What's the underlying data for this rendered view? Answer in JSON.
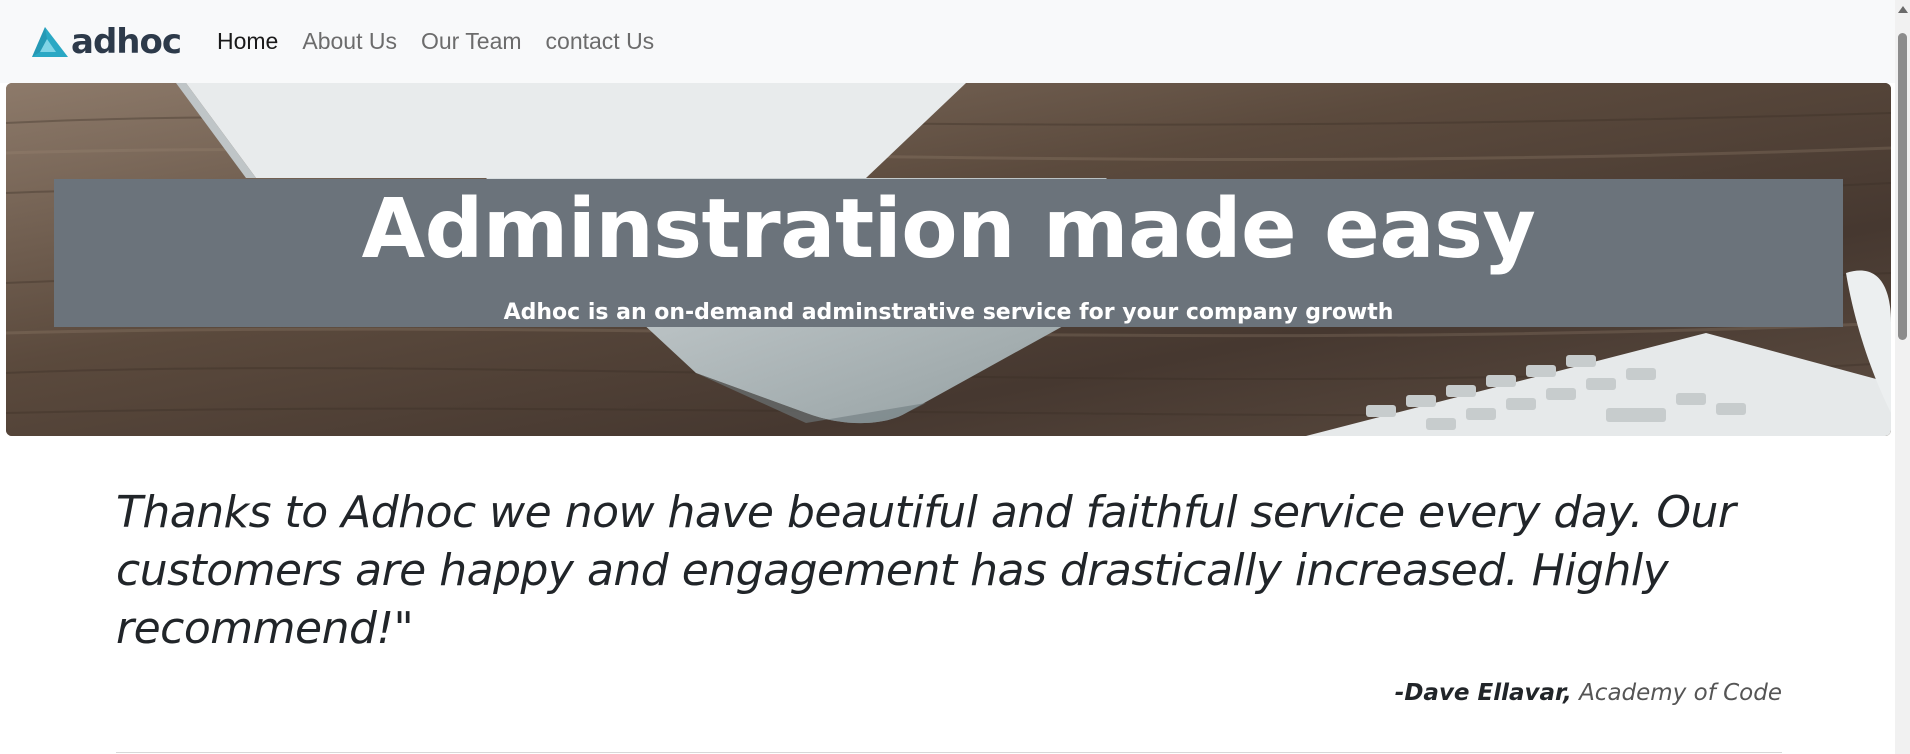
{
  "navbar": {
    "brand": {
      "text": "adhoc",
      "icon": "triangle-logo-icon",
      "colors": {
        "triangle": "#2aa8c4",
        "inner": "#7fd4e6",
        "text": "#2d3a4a"
      }
    },
    "links": [
      {
        "label": "Home",
        "active": true
      },
      {
        "label": "About Us",
        "active": false
      },
      {
        "label": "Our Team",
        "active": false
      },
      {
        "label": "contact Us",
        "active": false
      }
    ]
  },
  "hero": {
    "title": "Adminstration made easy",
    "subtitle": "Adhoc is an on-demand adminstrative service for your company growth",
    "background": "desk-with-imac-keyboard-photo",
    "band_color": "#6b737b"
  },
  "testimonial": {
    "quote": "Thanks to Adhoc we now have beautiful and faithful service every day. Our customers are happy and engagement has drastically increased. Highly recommend!\"",
    "author": "-Dave Ellavar,",
    "organization": "Academy of Code"
  },
  "colors": {
    "navbar_bg": "#f8f9fa",
    "text_dark": "#212529",
    "nav_muted": "#6c6c6c"
  }
}
